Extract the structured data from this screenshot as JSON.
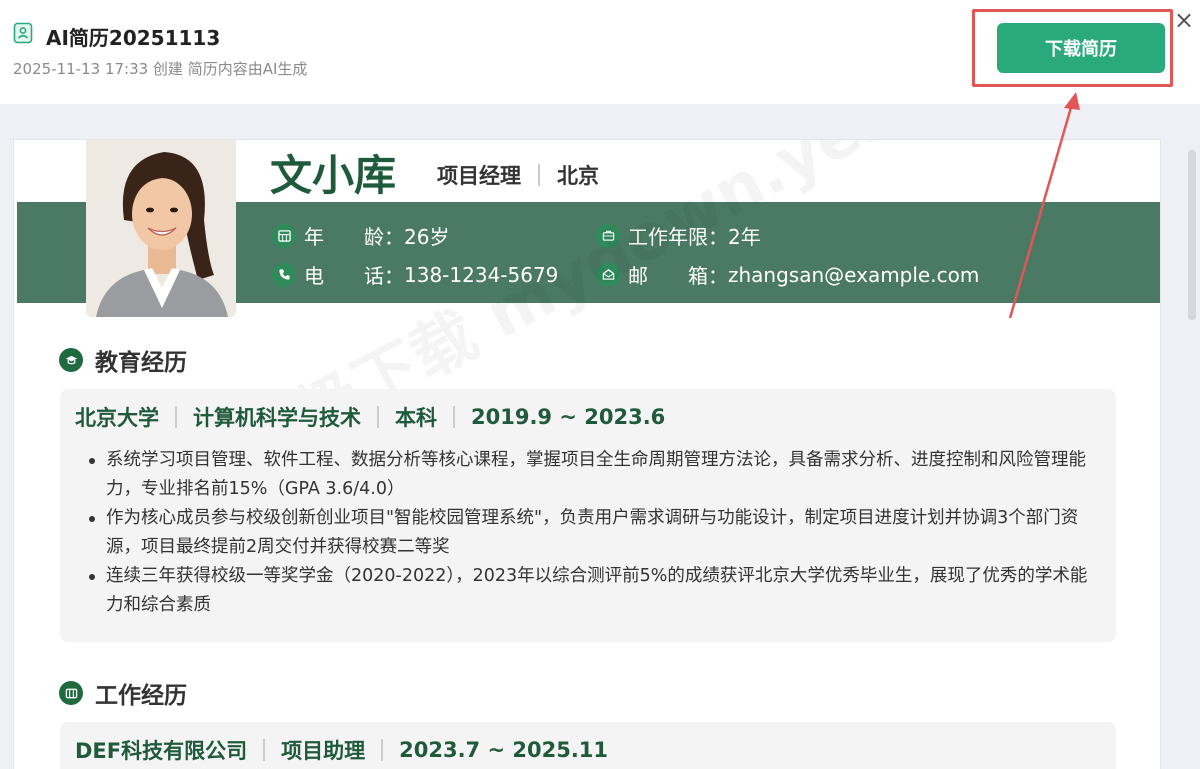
{
  "header": {
    "title": "AI简历20251113",
    "meta": "2025-11-13 17:33 创建 简历内容由AI生成",
    "download_label": "下载简历",
    "close_label": "×",
    "doc_icon": "resume-doc-icon"
  },
  "colors": {
    "accent_green": "#2aa97c",
    "band_green": "#4a7a63",
    "title_green": "#1f5a3c",
    "highlight_red": "#e25656"
  },
  "resume": {
    "name": "文小库",
    "position": "项目经理",
    "city": "北京",
    "watermark": "天极下载 mydown.yesky",
    "info": [
      {
        "icon": "calendar-icon",
        "label": "年　　龄：",
        "value": "26岁"
      },
      {
        "icon": "briefcase-icon",
        "label": "工作年限：",
        "value": "2年"
      },
      {
        "icon": "phone-icon",
        "label": "电　　话：",
        "value": "138-1234-5679"
      },
      {
        "icon": "mail-icon",
        "label": "邮　　箱：",
        "value": "zhangsan@example.com"
      }
    ],
    "education": {
      "title": "教育经历",
      "school": "北京大学",
      "major": "计算机科学与技术",
      "degree": "本科",
      "period": "2019.9 ~ 2023.6",
      "bullets": [
        "系统学习项目管理、软件工程、数据分析等核心课程，掌握项目全生命周期管理方法论，具备需求分析、进度控制和风险管理能力，专业排名前15%（GPA 3.6/4.0）",
        "作为核心成员参与校级创新创业项目\"智能校园管理系统\"，负责用户需求调研与功能设计，制定项目进度计划并协调3个部门资源，项目最终提前2周交付并获得校赛二等奖",
        "连续三年获得校级一等奖学金（2020-2022），2023年以综合测评前5%的成绩获评北京大学优秀毕业生，展现了优秀的学术能力和综合素质"
      ]
    },
    "work": {
      "title": "工作经历",
      "company": "DEF科技有限公司",
      "role": "项目助理",
      "period": "2023.7 ~ 2025.11"
    }
  }
}
